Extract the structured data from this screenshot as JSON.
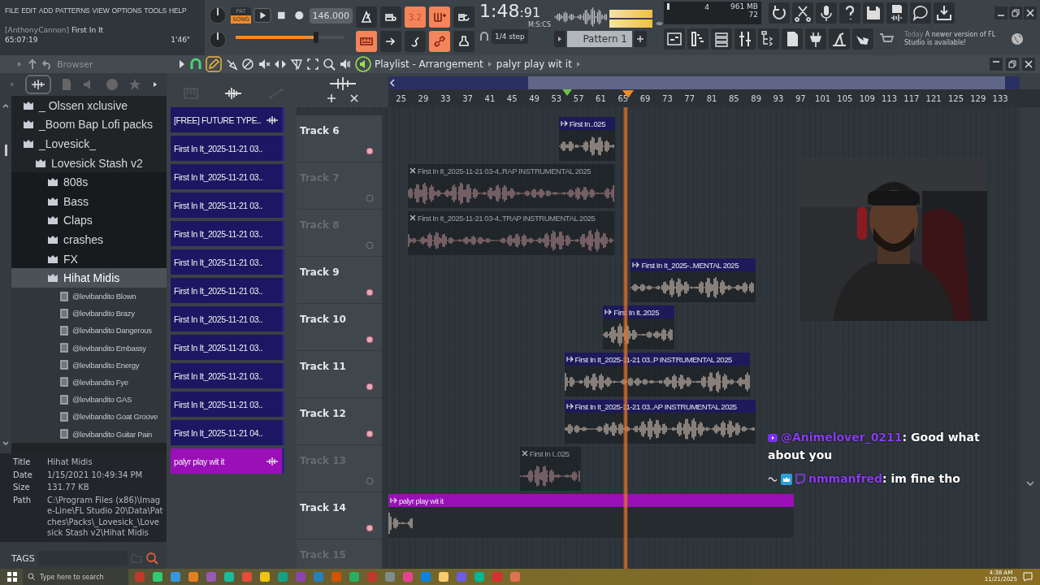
{
  "menu": [
    "FILE",
    "EDIT",
    "ADD",
    "PATTERNS",
    "VIEW",
    "OPTIONS",
    "TOOLS",
    "HELP"
  ],
  "hint": {
    "user": "[AnthonyCannon]",
    "song": "First In It",
    "time": "65:07:19",
    "length": "1'46\""
  },
  "transport": {
    "pat": "PAT",
    "song": "SONG",
    "song_mode": true,
    "tempo": "146.000",
    "time": "1:48",
    "time_cs": ":91",
    "time_label": "M:S:CS",
    "master": {
      "level": 0.74
    },
    "snap": "1/4 step",
    "pattern": "Pattern 1"
  },
  "toggles": [
    {
      "kind": "metronome",
      "on": false
    },
    {
      "kind": "wait",
      "on": false
    },
    {
      "kind": "countdown",
      "label": "3.2",
      "on": true
    },
    {
      "kind": "step",
      "on": true
    },
    {
      "kind": "loop",
      "on": false
    },
    {
      "kind": "typing",
      "on": true
    },
    {
      "kind": "arrow",
      "on": false
    },
    {
      "kind": "blend",
      "on": false
    },
    {
      "kind": "link",
      "on": true
    },
    {
      "kind": "stamp",
      "on": false
    }
  ],
  "monitor": {
    "cpu": "4",
    "memory": "961 MB",
    "polyphony": "72"
  },
  "notice": {
    "date": "Today",
    "text": "A newer version of FL Studio is available!"
  },
  "browser": {
    "title": "Browser",
    "tree": [
      {
        "name": "_ Olssen xclusive",
        "kind": "folder",
        "selected": false
      },
      {
        "name": "_Boom Bap Lofi packs",
        "kind": "folder",
        "selected": false
      },
      {
        "name": "_Lovesick_",
        "kind": "folder",
        "selected": false,
        "children": [
          {
            "name": "Lovesick Stash v2",
            "kind": "folder",
            "selected": false,
            "children": [
              {
                "name": "808s",
                "kind": "folder",
                "selected": false
              },
              {
                "name": "Bass",
                "kind": "folder",
                "selected": false
              },
              {
                "name": "Claps",
                "kind": "folder",
                "selected": false
              },
              {
                "name": "crashes",
                "kind": "folder",
                "selected": false
              },
              {
                "name": "FX",
                "kind": "folder",
                "selected": false
              },
              {
                "name": "Hihat Midis",
                "kind": "folder",
                "selected": true,
                "children": [
                  {
                    "name": "@levibandito Blown",
                    "kind": "midi",
                    "selected": false
                  },
                  {
                    "name": "@levibandito Brazy",
                    "kind": "midi",
                    "selected": false
                  },
                  {
                    "name": "@levibandito Dangerous",
                    "kind": "midi",
                    "selected": false
                  },
                  {
                    "name": "@levibandito Embassy",
                    "kind": "midi",
                    "selected": false
                  },
                  {
                    "name": "@levibandito Energy",
                    "kind": "midi",
                    "selected": false
                  },
                  {
                    "name": "@levibandito Fye",
                    "kind": "midi",
                    "selected": false
                  },
                  {
                    "name": "@levibandito GAS",
                    "kind": "midi",
                    "selected": false
                  },
                  {
                    "name": "@levibandito Goat Groove",
                    "kind": "midi",
                    "selected": false
                  },
                  {
                    "name": "@levibandito Guitar Pain",
                    "kind": "midi",
                    "selected": false
                  }
                ]
              }
            ]
          }
        ]
      }
    ],
    "info": [
      {
        "label": "Title",
        "value": "Hihat Midis"
      },
      {
        "label": "Date",
        "value": "1/15/2021 10:49:34 PM"
      },
      {
        "label": "Size",
        "value": "131.77 KB"
      },
      {
        "label": "Path",
        "value": "C:\\Program Files (x86)\\Image-Line\\FL Studio 20\\Data\\Patches\\Packs\\_Lovesick_\\Lovesick Stash v2\\Hihat Midis"
      }
    ],
    "tags": "TAGS"
  },
  "playlist": {
    "title": "Playlist - Arrangement",
    "pattern": "palyr play wit it",
    "clip_list": [
      {
        "name": "[FREE] FUTURE TYPE..",
        "icon": true,
        "selected": false
      },
      {
        "name": "First In It_2025-11-21 03..",
        "icon": false,
        "selected": false
      },
      {
        "name": "First In It_2025-11-21 03..",
        "icon": false,
        "selected": false
      },
      {
        "name": "First In It_2025-11-21 03..",
        "icon": false,
        "selected": false
      },
      {
        "name": "First In It_2025-11-21 03..",
        "icon": false,
        "selected": false
      },
      {
        "name": "First In It_2025-11-21 03..",
        "icon": false,
        "selected": false
      },
      {
        "name": "First In It_2025-11-21 03..",
        "icon": false,
        "selected": false
      },
      {
        "name": "First In It_2025-11-21 03..",
        "icon": false,
        "selected": false
      },
      {
        "name": "First In It_2025-11-21 03..",
        "icon": false,
        "selected": false
      },
      {
        "name": "First In It_2025-11-21 03..",
        "icon": false,
        "selected": false
      },
      {
        "name": "First In It_2025-11-21 03..",
        "icon": false,
        "selected": false
      },
      {
        "name": "First In It_2025-11-21 04..",
        "icon": false,
        "selected": false
      },
      {
        "name": "palyr play wit it",
        "icon": true,
        "selected": true
      }
    ],
    "ruler": [
      "25",
      "29",
      "33",
      "37",
      "41",
      "45",
      "49",
      "53",
      "57",
      "61",
      "65",
      "69",
      "73",
      "77",
      "81",
      "85",
      "89",
      "93",
      "97",
      "101",
      "105",
      "109",
      "113",
      "117",
      "121",
      "125",
      "129",
      "133"
    ],
    "tracks": [
      {
        "name": "Track 6",
        "muted": false,
        "clips": [
          {
            "title": "First In..025",
            "kind": "audio",
            "muted": false
          }
        ]
      },
      {
        "name": "Track 7",
        "muted": true,
        "clips": [
          {
            "title": "First In It_2025-11-21 03-4..RAP INSTRUMENTAL 2025",
            "kind": "audio",
            "muted": true
          }
        ]
      },
      {
        "name": "Track 8",
        "muted": true,
        "clips": [
          {
            "title": "First In It_2025-11-21 03-4..TRAP INSTRUMENTAL 2025",
            "kind": "audio",
            "muted": true
          }
        ]
      },
      {
        "name": "Track 9",
        "muted": false,
        "clips": [
          {
            "title": "First In It_2025-..MENTAL 2025",
            "kind": "audio",
            "muted": false
          }
        ]
      },
      {
        "name": "Track 10",
        "muted": false,
        "clips": [
          {
            "title": "First In It..2025",
            "kind": "audio",
            "muted": false
          }
        ]
      },
      {
        "name": "Track 11",
        "muted": false,
        "clips": [
          {
            "title": "First In It_2025-11-21 03..P INSTRUMENTAL 2025",
            "kind": "audio",
            "muted": false
          }
        ]
      },
      {
        "name": "Track 12",
        "muted": false,
        "clips": [
          {
            "title": "First In It_2025-11-21 03..AP INSTRUMENTAL 2025",
            "kind": "audio",
            "muted": false
          }
        ]
      },
      {
        "name": "Track 13",
        "muted": true,
        "clips": [
          {
            "title": "First In I..025",
            "kind": "audio",
            "muted": true
          }
        ]
      },
      {
        "name": "Track 14",
        "muted": false,
        "clips": [
          {
            "title": "palyr play wit it",
            "kind": "pattern",
            "muted": false
          }
        ]
      },
      {
        "name": "Track 15",
        "muted": true
      }
    ]
  },
  "chat": [
    {
      "kind": "youtube",
      "user": "@Animelover_0211",
      "text": ": Good what about you"
    },
    {
      "kind": "twitch",
      "user": "nmmanfred",
      "text": ": im fine tho"
    }
  ],
  "taskbar": {
    "search": "Type here to search",
    "time": "4:38 AM",
    "date": "11/21/2025"
  }
}
